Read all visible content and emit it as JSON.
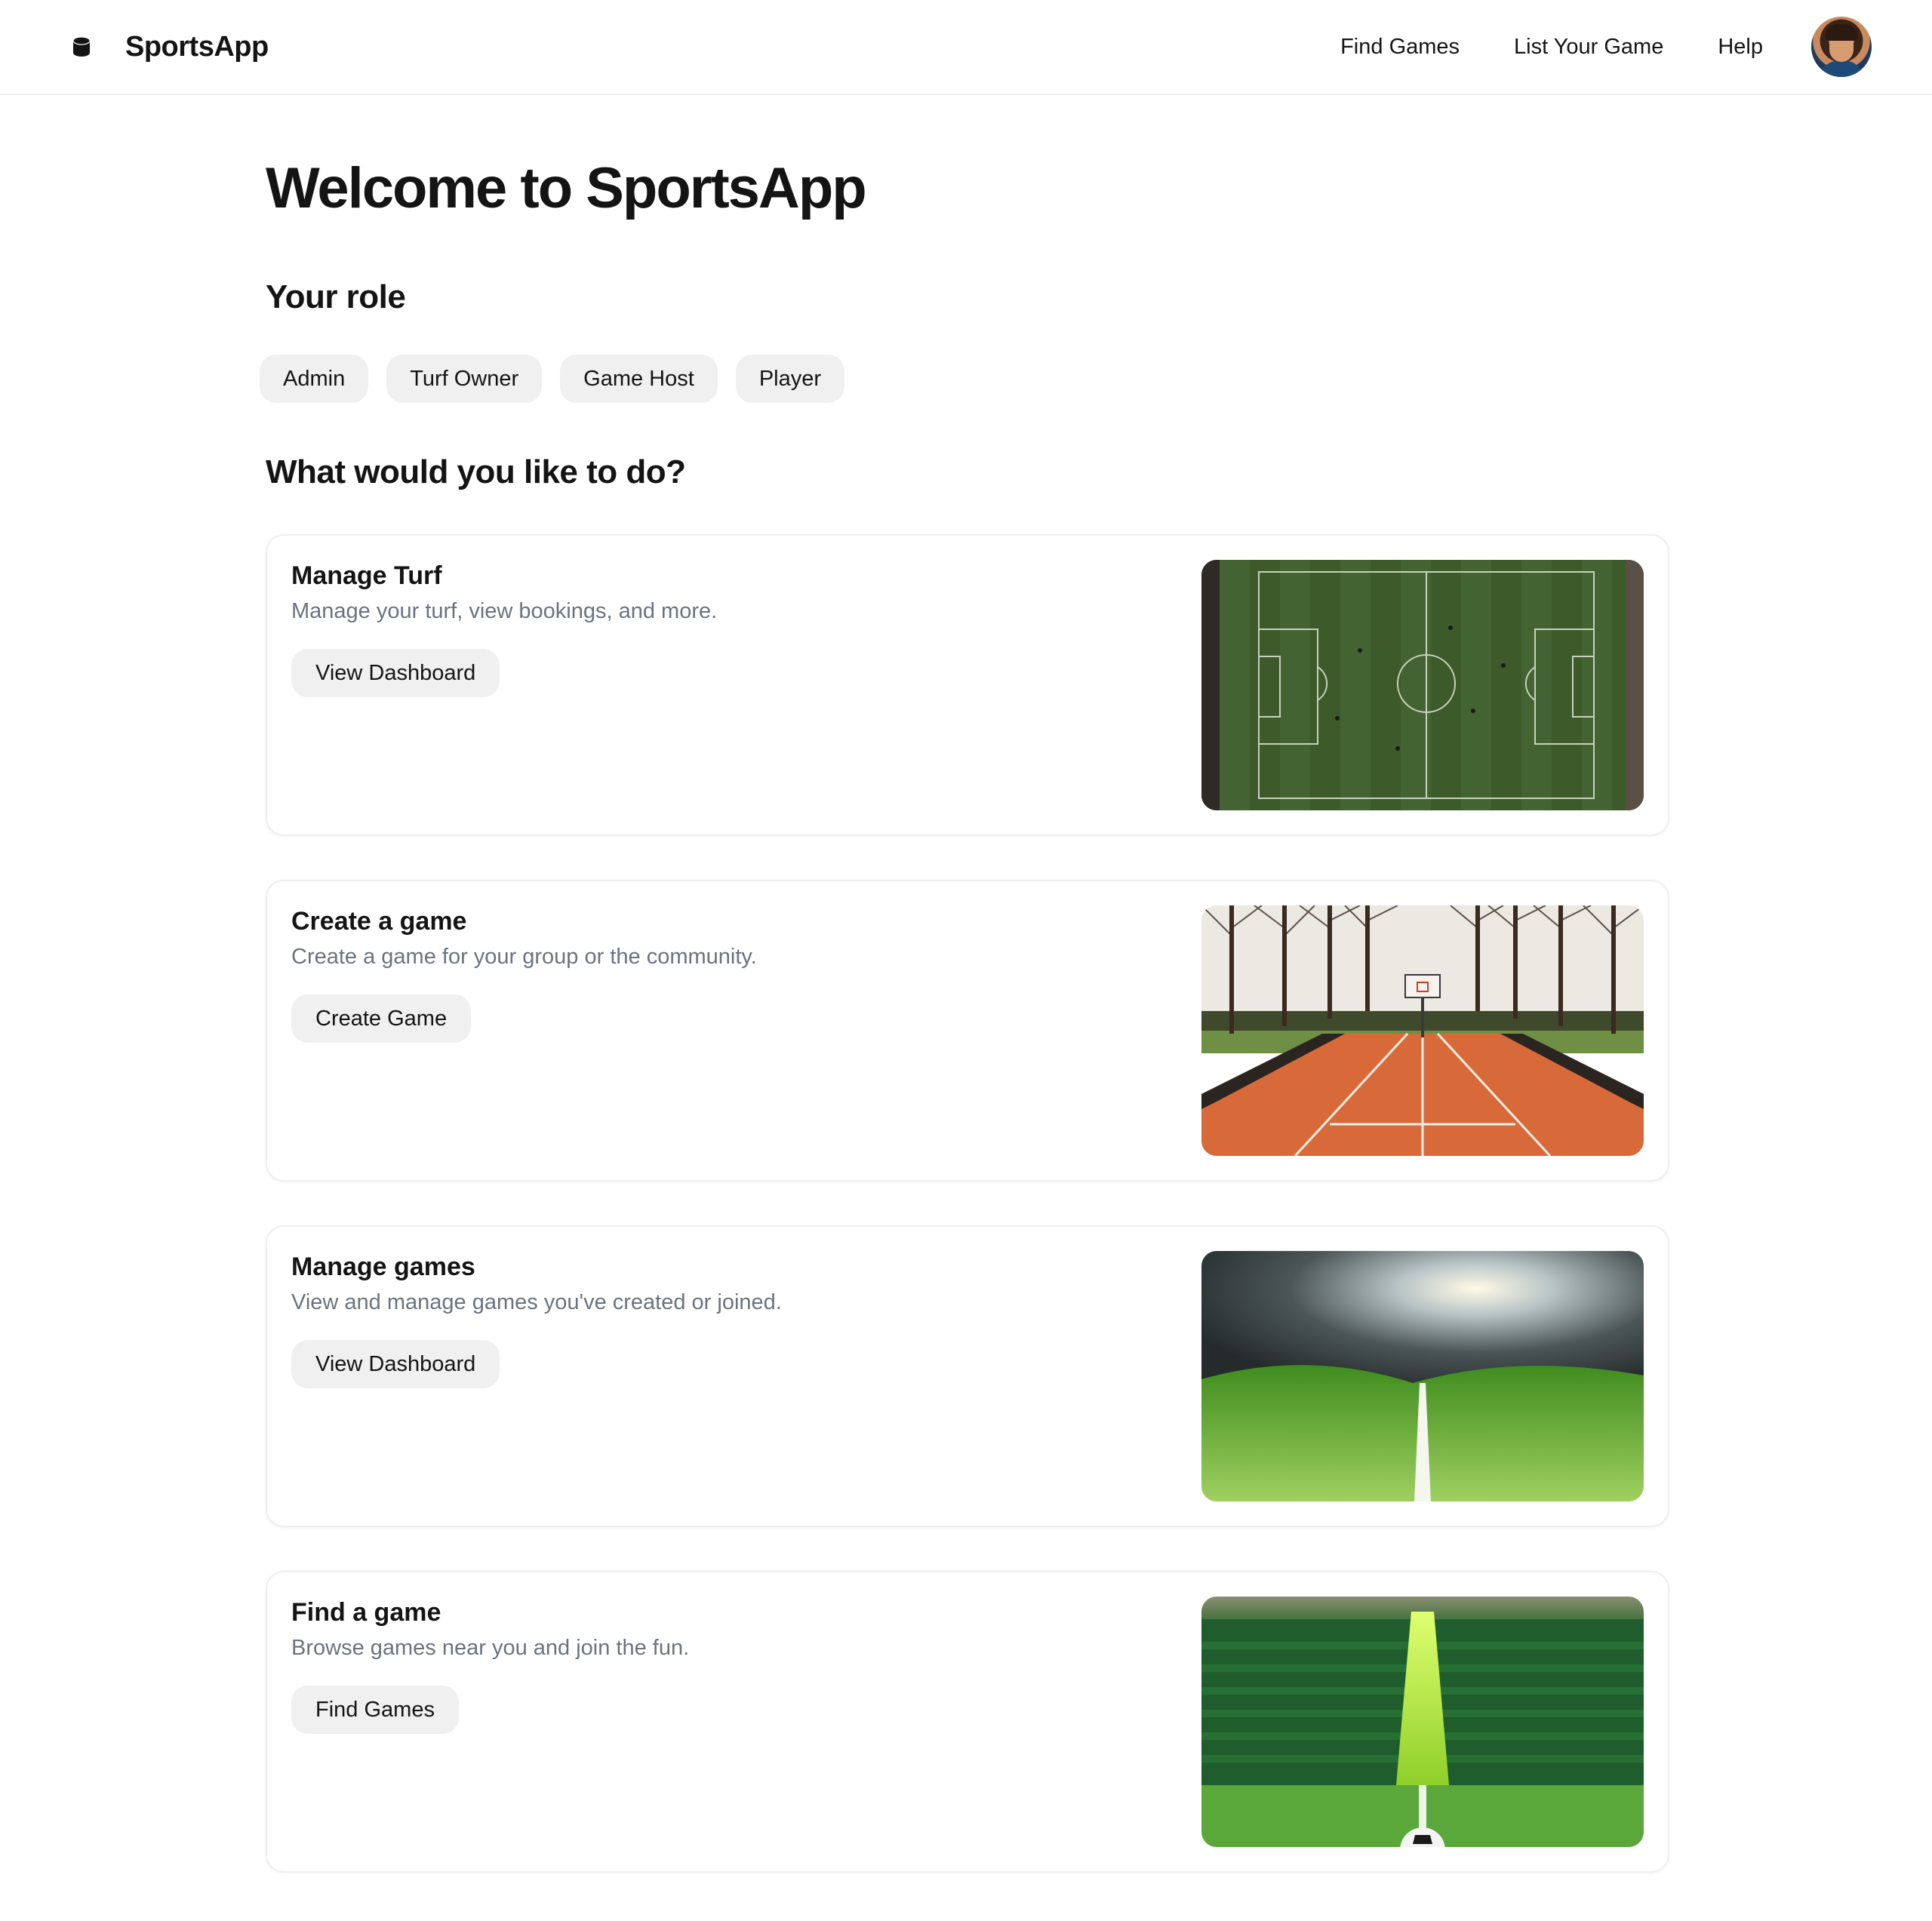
{
  "header": {
    "brand_name": "SportsApp",
    "brand_icon": "database-icon",
    "nav": {
      "find_games": "Find Games",
      "list_game": "List Your Game",
      "help": "Help"
    }
  },
  "main": {
    "title": "Welcome to SportsApp",
    "role_heading": "Your role",
    "roles": [
      "Admin",
      "Turf Owner",
      "Game Host",
      "Player"
    ],
    "actions_heading": "What would you like to do?",
    "cards": [
      {
        "title": "Manage Turf",
        "description": "Manage your turf, view bookings, and more.",
        "button": "View Dashboard",
        "image": "aerial football pitch"
      },
      {
        "title": "Create a game",
        "description": "Create a game for your group or the community.",
        "button": "Create Game",
        "image": "basketball court with trees"
      },
      {
        "title": "Manage games",
        "description": "View and manage games you've created or joined.",
        "button": "View Dashboard",
        "image": "green field under sunlit clouds"
      },
      {
        "title": "Find a game",
        "description": "Browse games near you and join the fun.",
        "button": "Find Games",
        "image": "green pitch with ball"
      }
    ]
  },
  "colors": {
    "chip_bg": "#f0f0f1",
    "muted_text": "#6b7380",
    "border": "#efefef"
  }
}
